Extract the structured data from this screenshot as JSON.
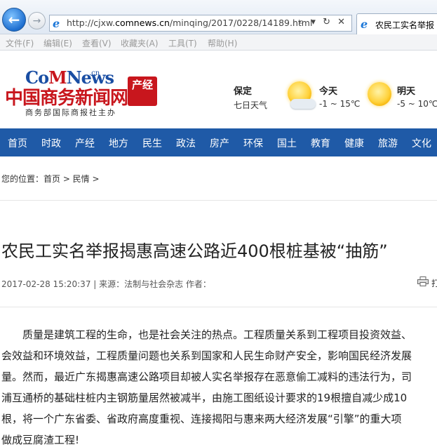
{
  "browser": {
    "url_prefix": "http://cjxw.",
    "url_host": "comnews.cn",
    "url_path": "/minqing/2017/0228/14189.html",
    "address_tools": "⌕ ▾ ↻ ✕",
    "tab_title": "农民工实名举报",
    "menu": [
      "文件(F)",
      "编辑(E)",
      "查看(V)",
      "收藏夹(A)",
      "工具(T)",
      "帮助(H)"
    ]
  },
  "site": {
    "logo_en_a": "Co",
    "logo_en_pulse": "M",
    "logo_en_b": "News",
    "logo_cn_small": ".cn",
    "logo_cn": "中国商务新闻网",
    "tagline": "商务部国际商报社主办",
    "badge": "产经"
  },
  "weather": {
    "city": "保定",
    "subtitle": "七日天气",
    "today_label": "今天",
    "today_temp": "-1 ~ 15℃",
    "tomorrow_label": "明天",
    "tomorrow_temp": "-5 ~ 10℃"
  },
  "nav": [
    "首页",
    "时政",
    "产经",
    "地方",
    "民生",
    "政法",
    "房产",
    "环保",
    "国土",
    "教育",
    "健康",
    "旅游",
    "文化"
  ],
  "breadcrumb": "您的位置：首页 > 民情 >",
  "article": {
    "title": "农民工实名举报揭惠高速公路近400根桩基被“抽筋”",
    "meta": "2017-02-28 15:20:37  |  来源：法制与社会杂志    作者：",
    "print_label": "打",
    "paragraph_lines": [
      "　　质量是建筑工程的生命，也是社会关注的热点。工程质量关系到工程项目投资效益、",
      "会效益和环境效益，工程质量问题也关系到国家和人民生命财产安全，影响国民经济发展",
      "量。然而，最近广东揭惠高速公路项目却被人实名举报存在恶意偷工减料的违法行为，司",
      "浦互通桥的基础柱桩内主钢筋量居然被减半，由施工图纸设计要求的19根擅自减少成10",
      "根，将一个广东省委、省政府高度重视、连接揭阳与惠来两大经济发展“引擎”的重大项",
      "做成豆腐渣工程!"
    ]
  },
  "colors": {
    "nav_bg": "#1f5aa7",
    "brand_red": "#c8161d",
    "brand_blue": "#1a4ea3"
  }
}
